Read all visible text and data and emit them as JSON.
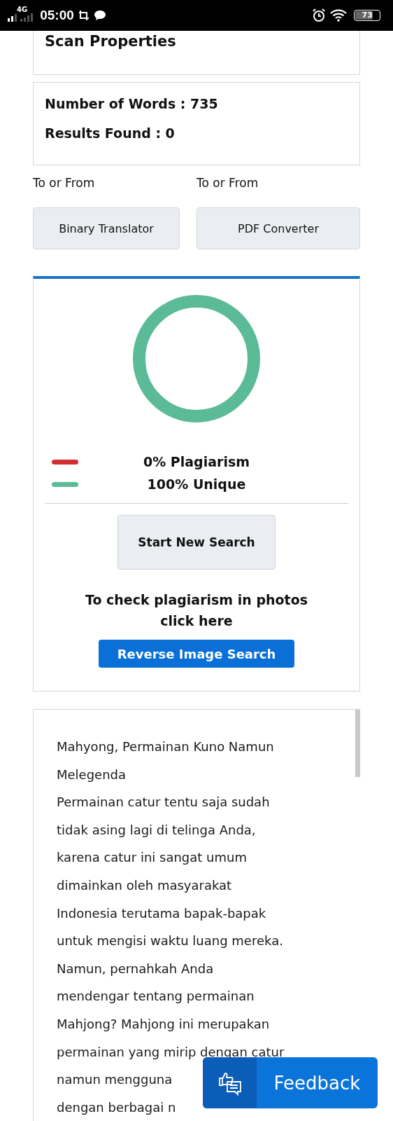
{
  "status_bar": {
    "network": "4G",
    "time": "05:00",
    "battery": "73"
  },
  "scan_properties": {
    "title": "Scan Properties"
  },
  "stats": [
    {
      "label": "Number of Words : ",
      "value": "735"
    },
    {
      "label": "Results Found : ",
      "value": "0"
    }
  ],
  "tools": [
    {
      "caption": "To or From",
      "button": "Binary Translator"
    },
    {
      "caption": "To or From",
      "button": "PDF Converter"
    }
  ],
  "result": {
    "legend": [
      {
        "label": "0% Plagiarism",
        "color": "#d32f2f"
      },
      {
        "label": "100% Unique",
        "color": "#5bbb97"
      }
    ],
    "start_button": "Start New Search",
    "photo_hint": "To check plagiarism in photos click here",
    "reverse_button": "Reverse Image Search"
  },
  "article": {
    "lines": [
      "Mahyong, Permainan Kuno Namun",
      "Melegenda",
      "Permainan catur tentu saja sudah",
      "tidak asing lagi di telinga Anda,",
      "karena catur ini sangat umum",
      "dimainkan oleh masyarakat",
      "Indonesia terutama bapak-bapak",
      "untuk mengisi waktu luang mereka.",
      "Namun, pernahkah Anda",
      "mendengar tentang permainan",
      "Mahjong? Mahjong ini merupakan",
      "permainan yang mirip dengan catur",
      "namun mengguna",
      "dengan berbagai n"
    ]
  },
  "feedback": {
    "label": "Feedback"
  }
}
